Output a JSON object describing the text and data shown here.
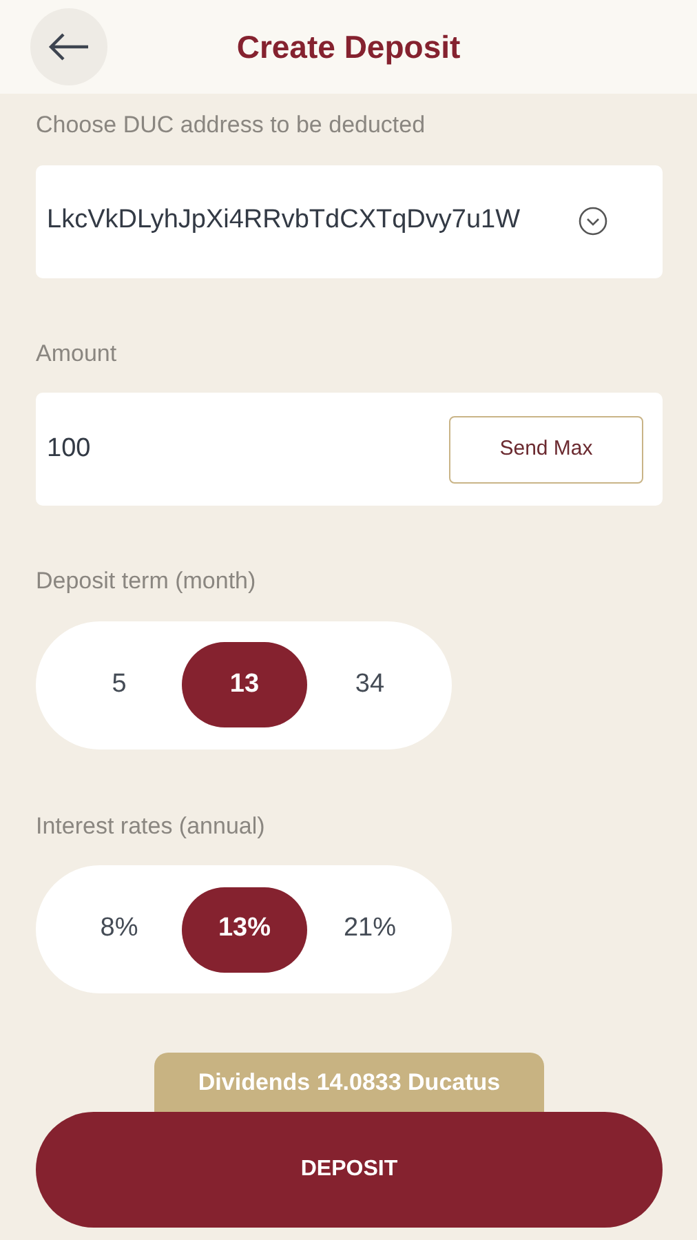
{
  "header": {
    "title": "Create Deposit"
  },
  "address": {
    "label": "Choose DUC address to be deducted",
    "value": "LkcVkDLyhJpXi4RRvbTdCXTqDvy7u1W"
  },
  "amount": {
    "label": "Amount",
    "value": "100",
    "button": "Send Max"
  },
  "term": {
    "label": "Deposit term (month)",
    "options": [
      {
        "label": "5",
        "selected": false
      },
      {
        "label": "13",
        "selected": true
      },
      {
        "label": "34",
        "selected": false
      }
    ]
  },
  "rates": {
    "label": "Interest rates (annual)",
    "options": [
      {
        "label": "8%",
        "selected": false
      },
      {
        "label": "13%",
        "selected": true
      },
      {
        "label": "21%",
        "selected": false
      }
    ]
  },
  "dividends": "Dividends 14.0833 Ducatus",
  "submit": "DEPOSIT"
}
